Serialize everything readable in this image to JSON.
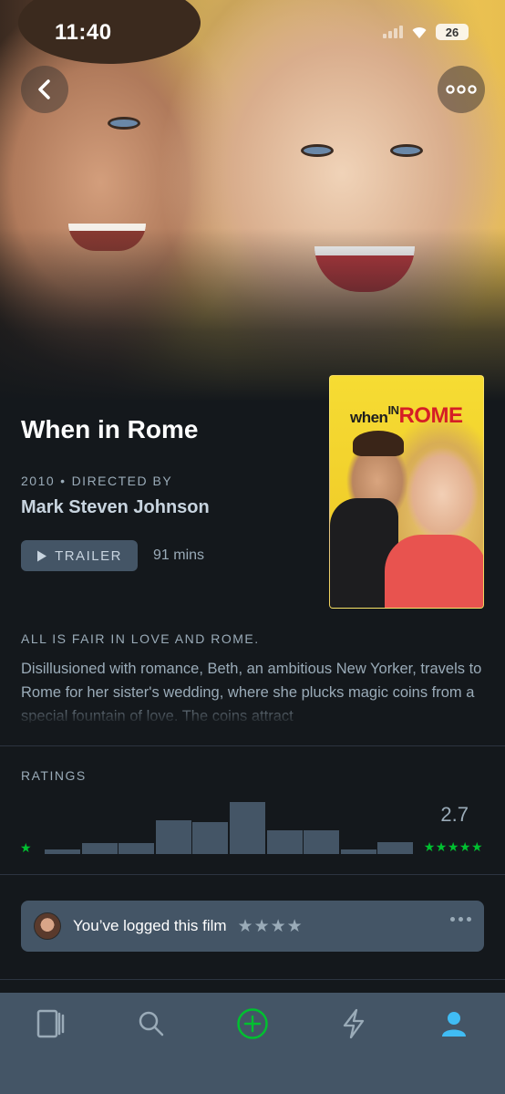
{
  "status_bar": {
    "time": "11:40",
    "battery": "26"
  },
  "film": {
    "title": "When in Rome",
    "year": "2010",
    "directed_by_label": "DIRECTED BY",
    "director": "Mark Steven Johnson",
    "trailer_label": "TRAILER",
    "runtime": "91 mins",
    "tagline": "ALL IS FAIR IN LOVE AND ROME.",
    "synopsis": "Disillusioned with romance, Beth, an ambitious New Yorker, travels to Rome for her sister's wedding, where she plucks magic coins from a special fountain of love. The coins attract"
  },
  "poster": {
    "logo_when": "when",
    "logo_in": "IN",
    "logo_rome": "ROME"
  },
  "ratings": {
    "label": "RATINGS",
    "average": "2.7",
    "histogram": [
      0.07,
      0.18,
      0.18,
      0.56,
      0.53,
      0.87,
      0.4,
      0.4,
      0.07,
      0.2
    ]
  },
  "log": {
    "text": "You’ve logged this film",
    "stars": "★★★★",
    "rating": 4
  },
  "tabs": [
    "films-icon",
    "search-icon",
    "add-icon",
    "activity-icon",
    "profile-icon"
  ],
  "colors": {
    "accent_green": "#00c030",
    "active_blue": "#40bcf4",
    "card": "#445566",
    "background": "#14181c"
  }
}
